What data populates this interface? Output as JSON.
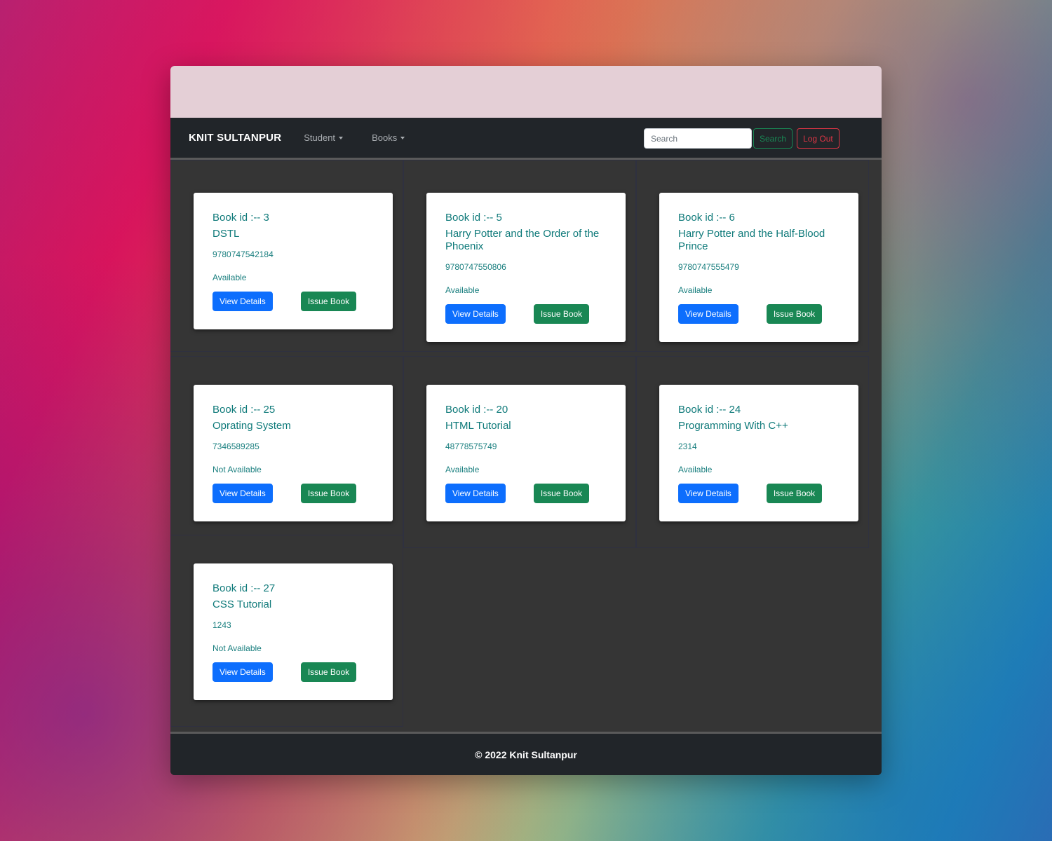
{
  "navbar": {
    "brand": "KNIT SULTANPUR",
    "menus": [
      {
        "label": "Student"
      },
      {
        "label": "Books"
      }
    ],
    "search": {
      "placeholder": "Search",
      "value": ""
    },
    "search_button": "Search",
    "logout_button": "Log Out"
  },
  "books": [
    {
      "id_label": "Book id :-- 3",
      "title": "DSTL",
      "isbn": "9780747542184",
      "status": "Available",
      "view_label": "View Details",
      "issue_label": "Issue Book"
    },
    {
      "id_label": "Book id :-- 5",
      "title": "Harry Potter and the Order of the Phoenix",
      "isbn": "9780747550806",
      "status": "Available",
      "view_label": "View Details",
      "issue_label": "Issue Book"
    },
    {
      "id_label": "Book id :-- 6",
      "title": "Harry Potter and the Half-Blood Prince",
      "isbn": "9780747555479",
      "status": "Available",
      "view_label": "View Details",
      "issue_label": "Issue Book"
    },
    {
      "id_label": "Book id :-- 25",
      "title": "Oprating System",
      "isbn": "7346589285",
      "status": "Not Available",
      "view_label": "View Details",
      "issue_label": "Issue Book"
    },
    {
      "id_label": "Book id :-- 20",
      "title": "HTML Tutorial",
      "isbn": "48778575749",
      "status": "Available",
      "view_label": "View Details",
      "issue_label": "Issue Book"
    },
    {
      "id_label": "Book id :-- 24",
      "title": "Programming With C++",
      "isbn": "2314",
      "status": "Available",
      "view_label": "View Details",
      "issue_label": "Issue Book"
    },
    {
      "id_label": "Book id :-- 27",
      "title": "CSS Tutorial",
      "isbn": "1243",
      "status": "Not Available",
      "view_label": "View Details",
      "issue_label": "Issue Book"
    }
  ],
  "footer": {
    "text": "© 2022 Knit Sultanpur"
  },
  "colors": {
    "navbar": "#212529",
    "content": "#353535",
    "card_text": "#0f7a7a",
    "primary": "#0d6efd",
    "success": "#198754",
    "danger": "#dc3545"
  }
}
